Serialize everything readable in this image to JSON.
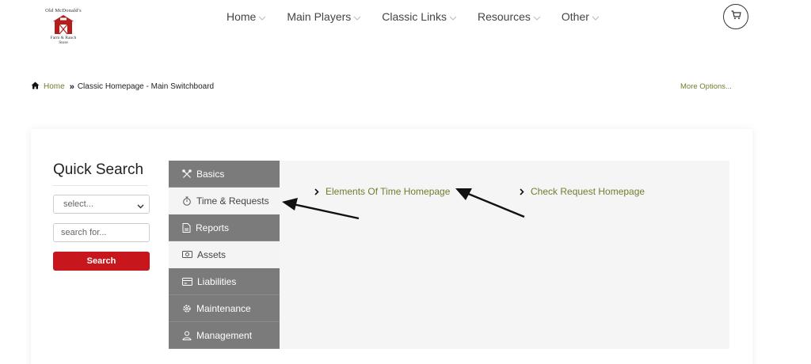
{
  "header": {
    "logo": {
      "line1": "Old McDonald's",
      "line2": "Farm & Ranch",
      "line3": "Store"
    },
    "nav": [
      {
        "label": "Home"
      },
      {
        "label": "Main Players"
      },
      {
        "label": "Classic Links"
      },
      {
        "label": "Resources"
      },
      {
        "label": "Other"
      }
    ],
    "cart_icon": "cart-icon"
  },
  "breadcrumb": {
    "home_icon": "home-icon",
    "home": "Home",
    "separator": "»",
    "current": "Classic Homepage - Main Switchboard"
  },
  "more_options": "More Options...",
  "quick_search": {
    "title": "Quick Search",
    "select_value": "select...",
    "input_placeholder": "search for...",
    "button": "Search"
  },
  "tabs": [
    {
      "label": "Basics",
      "icon": "tools-icon"
    },
    {
      "label": "Time & Requests",
      "icon": "stopwatch-icon",
      "active": true
    },
    {
      "label": "Reports",
      "icon": "report-icon"
    },
    {
      "label": "Assets",
      "icon": "cash-icon",
      "light": true
    },
    {
      "label": "Liabilities",
      "icon": "card-icon"
    },
    {
      "label": "Maintenance",
      "icon": "gear-icon"
    },
    {
      "label": "Management",
      "icon": "user-icon"
    }
  ],
  "panel": {
    "links": [
      {
        "label": "Elements Of Time Homepage"
      },
      {
        "label": "Check Request Homepage"
      }
    ]
  },
  "colors": {
    "accent_green": "#6d7f2e",
    "search_red": "#c8161d",
    "tab_gray": "#7b7b7b",
    "panel_bg": "#f5f5f5",
    "barn_red": "#b71c1c"
  }
}
